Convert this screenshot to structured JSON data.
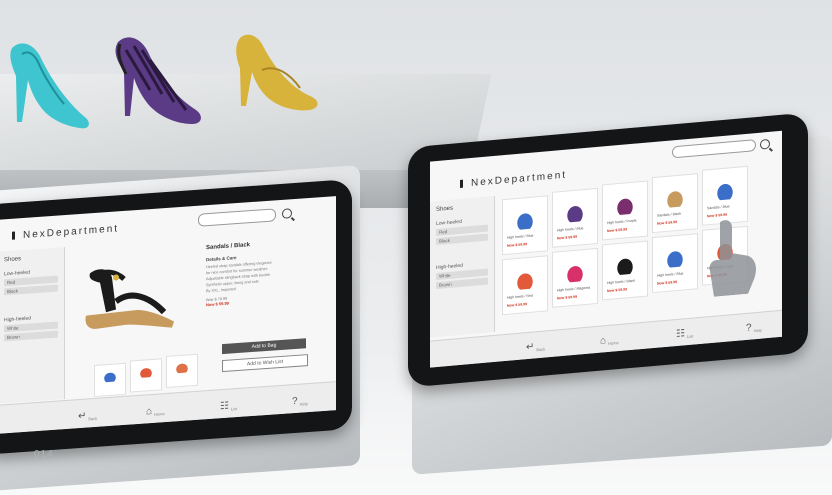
{
  "page_number": "014",
  "left_kiosk": {
    "brand": "NexDepartment",
    "sidebar": {
      "title": "Shoes",
      "groups": [
        {
          "label": "Low-heeled",
          "options": [
            "Red",
            "Black"
          ]
        },
        {
          "label": "High-heeled",
          "options": [
            "White",
            "Brown"
          ]
        }
      ]
    },
    "product": {
      "title": "Sandals / Black",
      "details_heading": "Details & Care",
      "details": [
        "Heeled strap sandals offering elegance",
        "for nice comfort for summer weather.",
        "Adjustable slingback strap with buckle",
        "Synthetic upper; lining and sole",
        "By XXL, Imported",
        "Was $ 79.99",
        "Now $ 59.99"
      ],
      "add_to_bag": "Add to Bag",
      "add_to_wishlist": "Add to Wish List"
    },
    "nav": {
      "back": "Back",
      "home": "Home",
      "list": "List",
      "help": "Help"
    }
  },
  "right_kiosk": {
    "brand": "NexDepartment",
    "sidebar": {
      "title": "Shoes",
      "groups": [
        {
          "label": "Low-heeled",
          "options": [
            "Red",
            "Black"
          ]
        },
        {
          "label": "High-heeled",
          "options": [
            "White",
            "Brown"
          ]
        }
      ]
    },
    "tiles": [
      {
        "title": "High heels / Blue",
        "price": "Now $ 59.99"
      },
      {
        "title": "High heels / Blue",
        "price": "Now $ 59.99"
      },
      {
        "title": "High heels / Purple",
        "price": "Now $ 59.99"
      },
      {
        "title": "Sandals / Black",
        "price": "Now $ 59.99"
      },
      {
        "title": "Sandals / Blue",
        "price": "Now $ 59.99"
      },
      {
        "title": "High heels / Red",
        "price": "Now $ 59.99"
      },
      {
        "title": "High heels / Magenta",
        "price": "Now $ 59.99"
      },
      {
        "title": "High heels / Black",
        "price": "Now $ 59.99"
      },
      {
        "title": "High heels / Blue",
        "price": "Now $ 59.99"
      },
      {
        "title": "High heels / Red",
        "price": "Now $ 59.99"
      }
    ],
    "nav": {
      "back": "Back",
      "home": "Home",
      "list": "List",
      "help": "Help"
    }
  },
  "colors": {
    "price_red": "#d0311b",
    "turquoise": "#3fc5cf",
    "purple": "#5b3a86",
    "gold": "#d8b33b",
    "black": "#1b1b1b",
    "cork": "#c79a5d",
    "bezel": "#141516"
  }
}
